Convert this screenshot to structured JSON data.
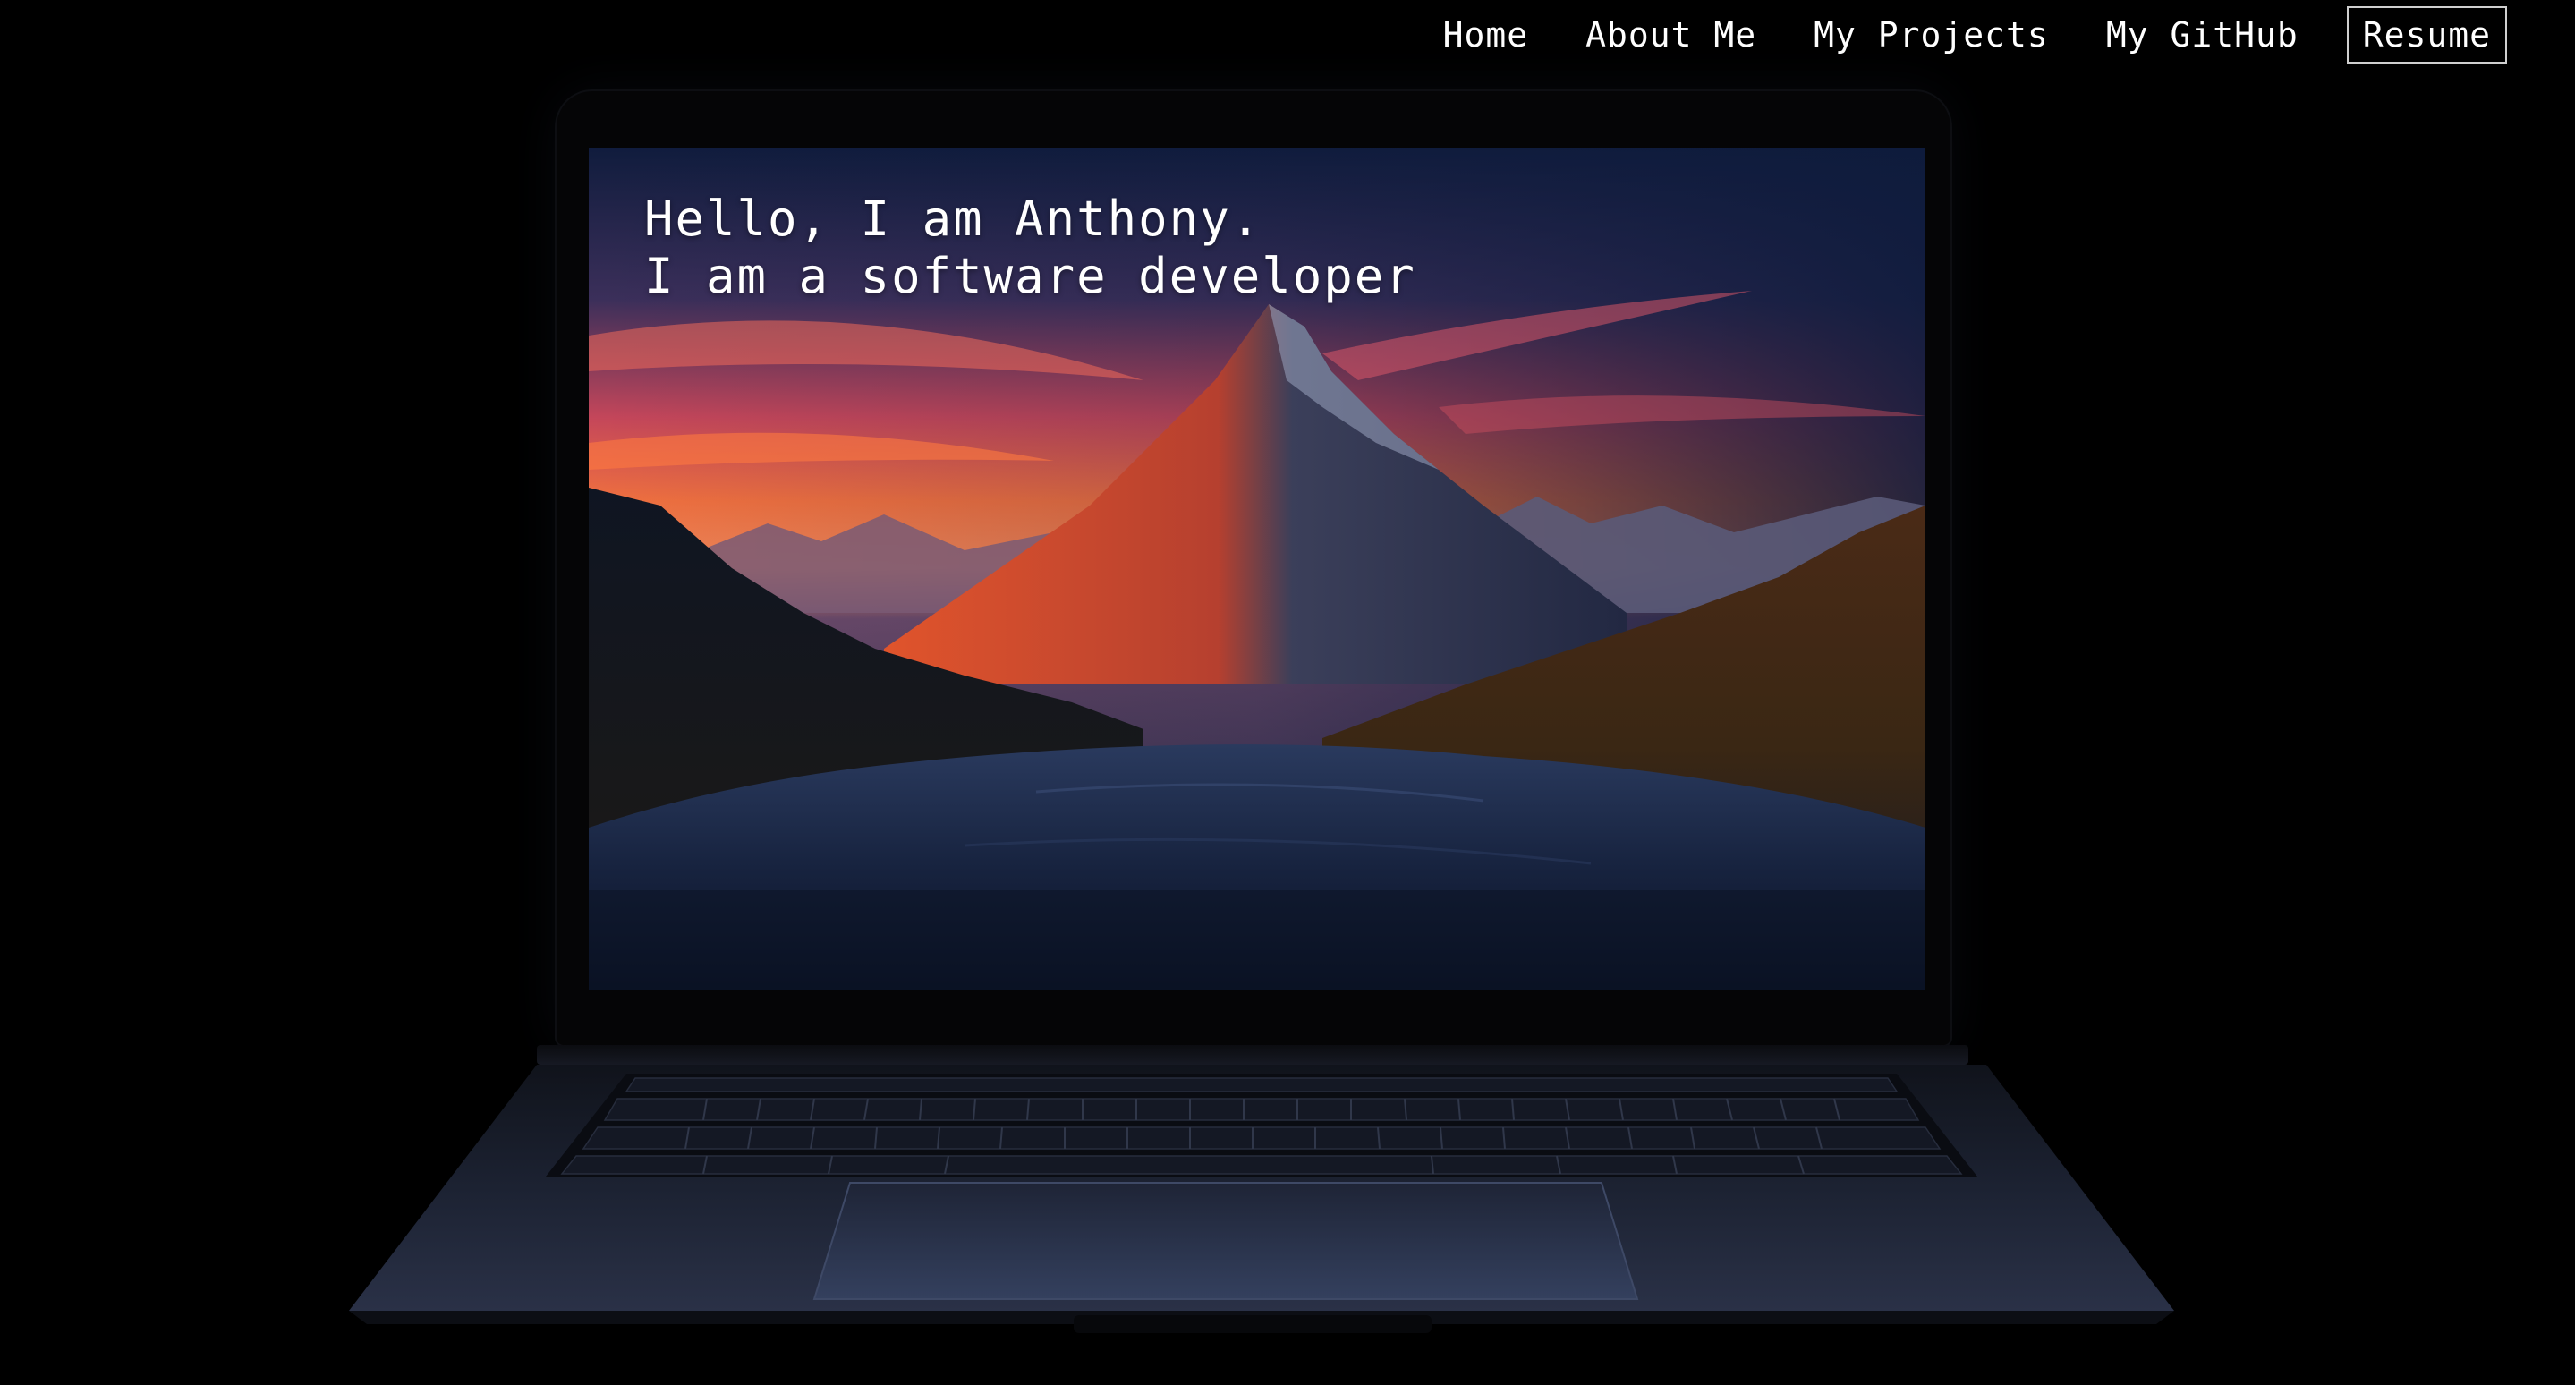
{
  "nav": {
    "items": [
      {
        "label": "Home"
      },
      {
        "label": "About Me"
      },
      {
        "label": "My Projects"
      },
      {
        "label": "My GitHub"
      },
      {
        "label": "Resume"
      }
    ]
  },
  "hero": {
    "line1": "Hello, I am Anthony.",
    "line2": "I am a software developer"
  },
  "colors": {
    "background": "#000000",
    "text": "#ffffff",
    "sky_top": "#0b1a3a",
    "sunset": "#f06a4a",
    "water": "#16233f"
  },
  "icons": {
    "hero_image": "mountain-lake-sunset-illustration",
    "device": "laptop-illustration"
  }
}
